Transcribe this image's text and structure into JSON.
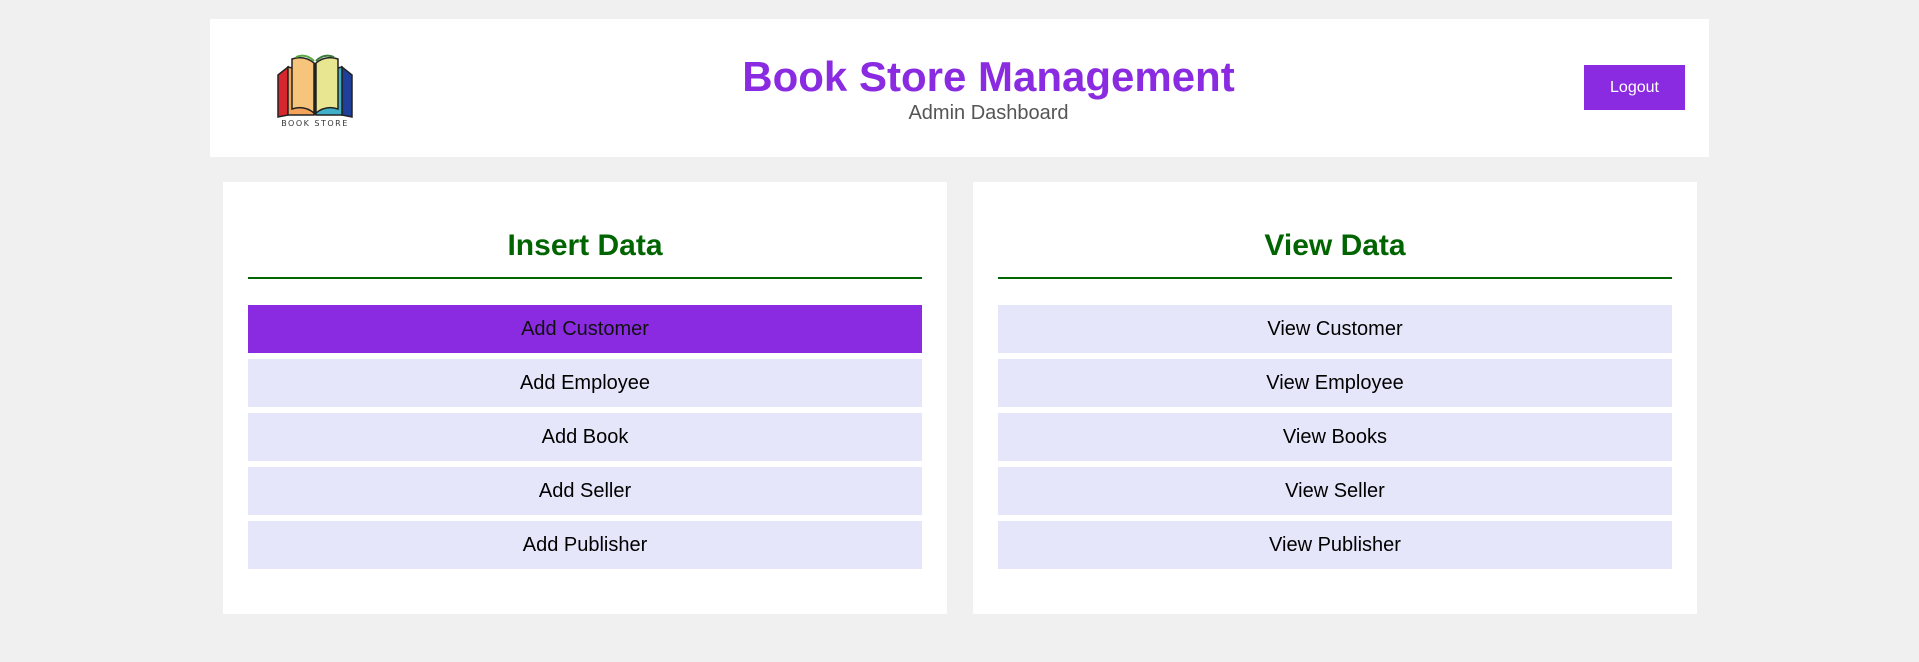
{
  "header": {
    "logo_text": "BOOK STORE",
    "title": "Book Store Management",
    "subtitle": "Admin Dashboard",
    "logout_label": "Logout"
  },
  "insert_panel": {
    "title": "Insert Data",
    "buttons": [
      {
        "label": "Add Customer",
        "active": true
      },
      {
        "label": "Add Employee"
      },
      {
        "label": "Add Book"
      },
      {
        "label": "Add Seller"
      },
      {
        "label": "Add Publisher"
      }
    ]
  },
  "view_panel": {
    "title": "View Data",
    "buttons": [
      {
        "label": "View Customer"
      },
      {
        "label": "View Employee"
      },
      {
        "label": "View Books"
      },
      {
        "label": "View Seller"
      },
      {
        "label": "View Publisher"
      }
    ]
  },
  "colors": {
    "accent": "#8a2be2",
    "panel_title": "#006400",
    "button_bg": "#e6e6fa",
    "page_bg": "#f0f0f0"
  },
  "icons": {
    "logo": "open-book-logo"
  }
}
